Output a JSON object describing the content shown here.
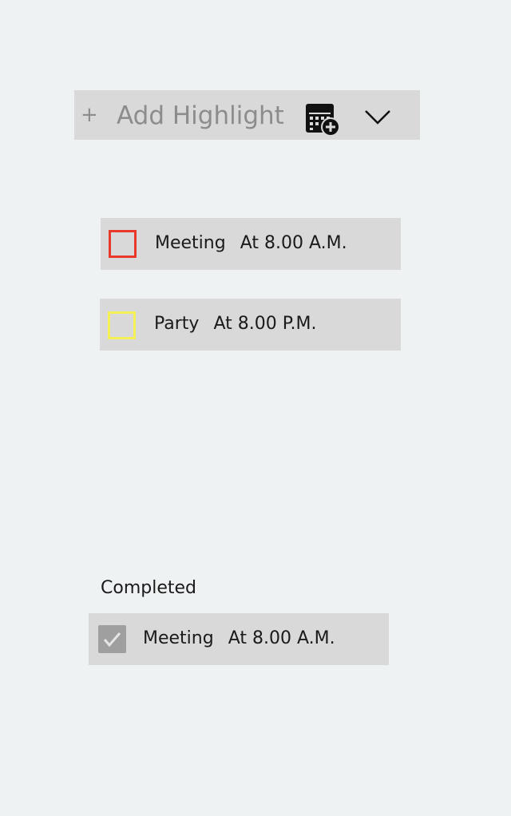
{
  "add_bar": {
    "plus": "+",
    "label": "Add Highlight",
    "calendar_icon": "calendar-add-icon",
    "chevron_icon": "chevron-down-icon"
  },
  "tasks": [
    {
      "title": "Meeting",
      "time": "At 8.00 A.M.",
      "checkbox_color": "#e8392a",
      "checked": false
    },
    {
      "title": "Party",
      "time": "At 8.00 P.M.",
      "checkbox_color": "#f5f055",
      "checked": false
    }
  ],
  "completed": {
    "heading": "Completed",
    "items": [
      {
        "title": "Meeting",
        "time": "At 8.00 A.M.",
        "checked": true
      }
    ]
  }
}
